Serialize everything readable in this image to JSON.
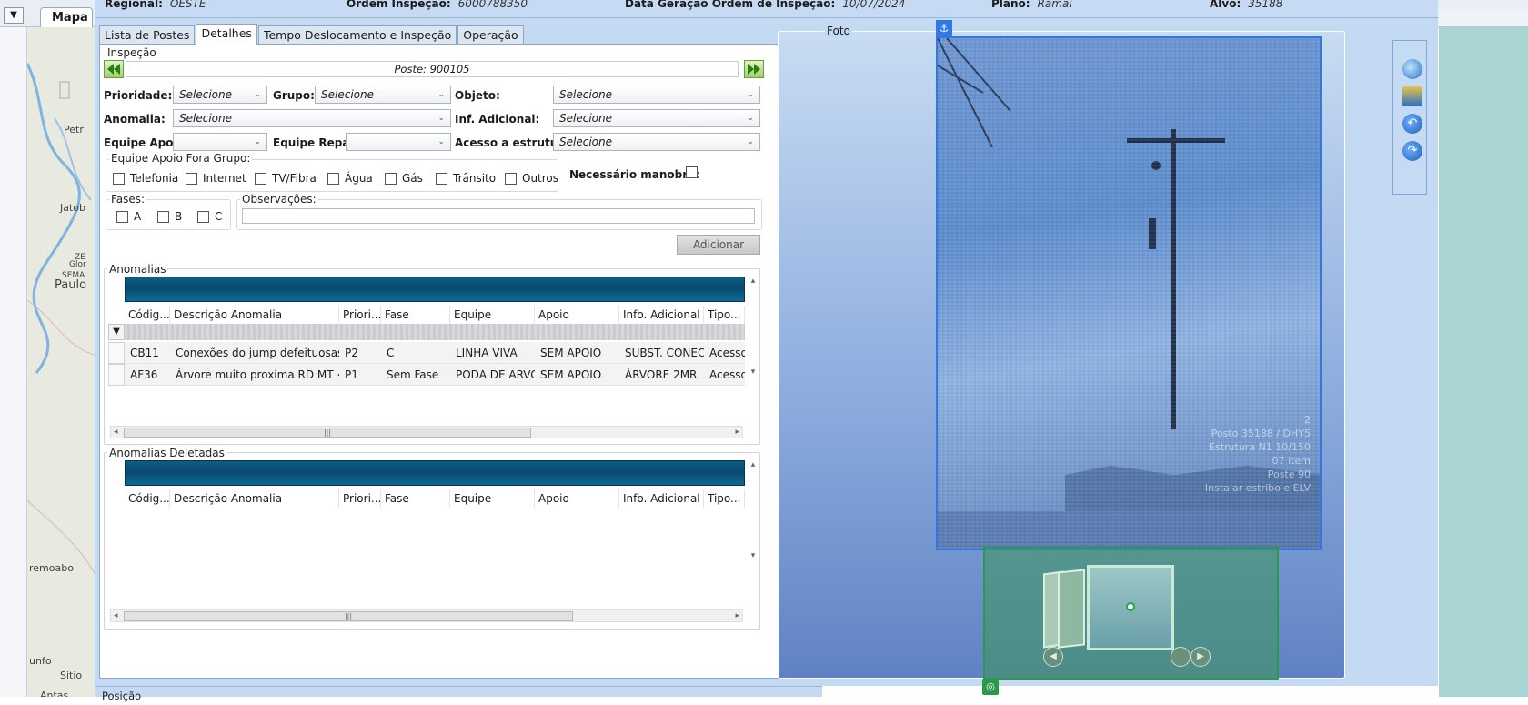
{
  "background": {
    "dropdown_glyph": "▼",
    "map_tab_label": "Mapa",
    "map_labels": [
      "Petr",
      "Jatob",
      "ZE",
      "Glor",
      "SEMA",
      "Paulo",
      "remoabo",
      "unfo",
      "Sitio",
      "Antas"
    ]
  },
  "header": {
    "fields": [
      {
        "label": "Regional:",
        "value": "OESTE"
      },
      {
        "label": "Ordem Inspeção:",
        "value": "6000788350"
      },
      {
        "label": "Data Geração Ordem de Inspeção:",
        "value": "10/07/2024"
      },
      {
        "label": "Plano:",
        "value": "Ramal"
      },
      {
        "label": "Alvo:",
        "value": "35188"
      }
    ]
  },
  "tabs": [
    "Lista de Postes",
    "Detalhes",
    "Tempo Deslocamento e Inspeção",
    "Operação"
  ],
  "active_tab": "Detalhes",
  "inspecao": {
    "group_label": "Inspeção",
    "poste_label": "Poste: 900105",
    "prioridade": {
      "label": "Prioridade:",
      "value": "Selecione"
    },
    "grupo": {
      "label": "Grupo:",
      "value": "Selecione"
    },
    "objeto": {
      "label": "Objeto:",
      "value": "Selecione"
    },
    "anomalia": {
      "label": "Anomalia:",
      "value": "Selecione"
    },
    "inf_adicional": {
      "label": "Inf. Adicional:",
      "value": "Selecione"
    },
    "equipe_apoio": {
      "label": "Equipe Apoio:",
      "value": ""
    },
    "equipe_reparo": {
      "label": "Equipe Reparo",
      "value": ""
    },
    "acesso_estrutura": {
      "label": "Acesso a estrutura:",
      "value": "Selecione"
    },
    "fora_grupo": {
      "label": "Equipe Apoio Fora Grupo:",
      "options": [
        "Telefonia",
        "Internet",
        "TV/Fibra",
        "Água",
        "Gás",
        "Trânsito",
        "Outros"
      ]
    },
    "necessario_manobra": "Necessário manobra:",
    "fases": {
      "label": "Fases:",
      "options": [
        "A",
        "B",
        "C"
      ]
    },
    "observacoes": {
      "label": "Observações:",
      "value": ""
    },
    "add_button": "Adicionar"
  },
  "anomalias": {
    "label": "Anomalias",
    "columns": [
      "Códig...",
      "Descrição Anomalia",
      "Priori...",
      "Fase",
      "Equipe",
      "Apoio",
      "Info. Adicional",
      "Tipo..."
    ],
    "rows": [
      [
        "CB11",
        "Conexões do jump defeituosas",
        "P2",
        "C",
        "LINHA VIVA",
        "SEM APOIO",
        "SUBST. CONECT...",
        "Acesso..."
      ],
      [
        "AF36",
        "Árvore muito proxima RD MT < d...",
        "P1",
        "Sem Fase",
        "PODA DE ARVO...",
        "SEM APOIO",
        "ÁRVORE 2MR",
        "Acesso..."
      ]
    ]
  },
  "anomalias_deletadas": {
    "label": "Anomalias Deletadas",
    "columns": [
      "Códig...",
      "Descrição Anomalia",
      "Priori...",
      "Fase",
      "Equipe",
      "Apoio",
      "Info. Adicional",
      "Tipo..."
    ]
  },
  "foto": {
    "label": "Foto",
    "overlay_text": [
      "2",
      "Posto 35188 / DHY5",
      "Estrutura N1 10/150",
      "07 item",
      "Poste 90",
      "Instalar estribo e ELV"
    ],
    "tools": [
      "zoom-icon",
      "fit-icon",
      "rotate-left-icon",
      "rotate-right-icon"
    ]
  },
  "footer": {
    "posicao": "Posição"
  },
  "colors": {
    "accent": "#2f78e6",
    "carousel": "#2a9a4a",
    "grid_band": "#0a4a6e"
  }
}
